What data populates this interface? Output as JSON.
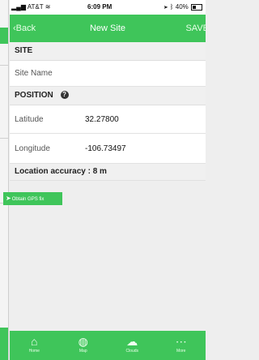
{
  "status_bar": {
    "carrier": "AT&T",
    "time": "6:09 PM",
    "battery": "40%"
  },
  "nav": {
    "back_label": "Back",
    "title": "New Site",
    "save_label": "SAVE"
  },
  "site_section": {
    "header": "SITE",
    "site_name_label": "Site Name"
  },
  "position_section": {
    "header": "POSITION",
    "latitude_label": "Latitude",
    "latitude_value": "32.27800",
    "longitude_label": "Longitude",
    "longitude_value": "-106.73497",
    "accuracy": "Location accuracy : 8 m",
    "gps_button": "Obtain GPS fix"
  },
  "tabs": [
    {
      "label": "Home",
      "icon": "home-icon"
    },
    {
      "label": "Map",
      "icon": "globe-icon"
    },
    {
      "label": "Clouds",
      "icon": "cloud-icon"
    },
    {
      "label": "More",
      "icon": "more-icon"
    }
  ],
  "colors": {
    "accent": "#3fc55a"
  }
}
